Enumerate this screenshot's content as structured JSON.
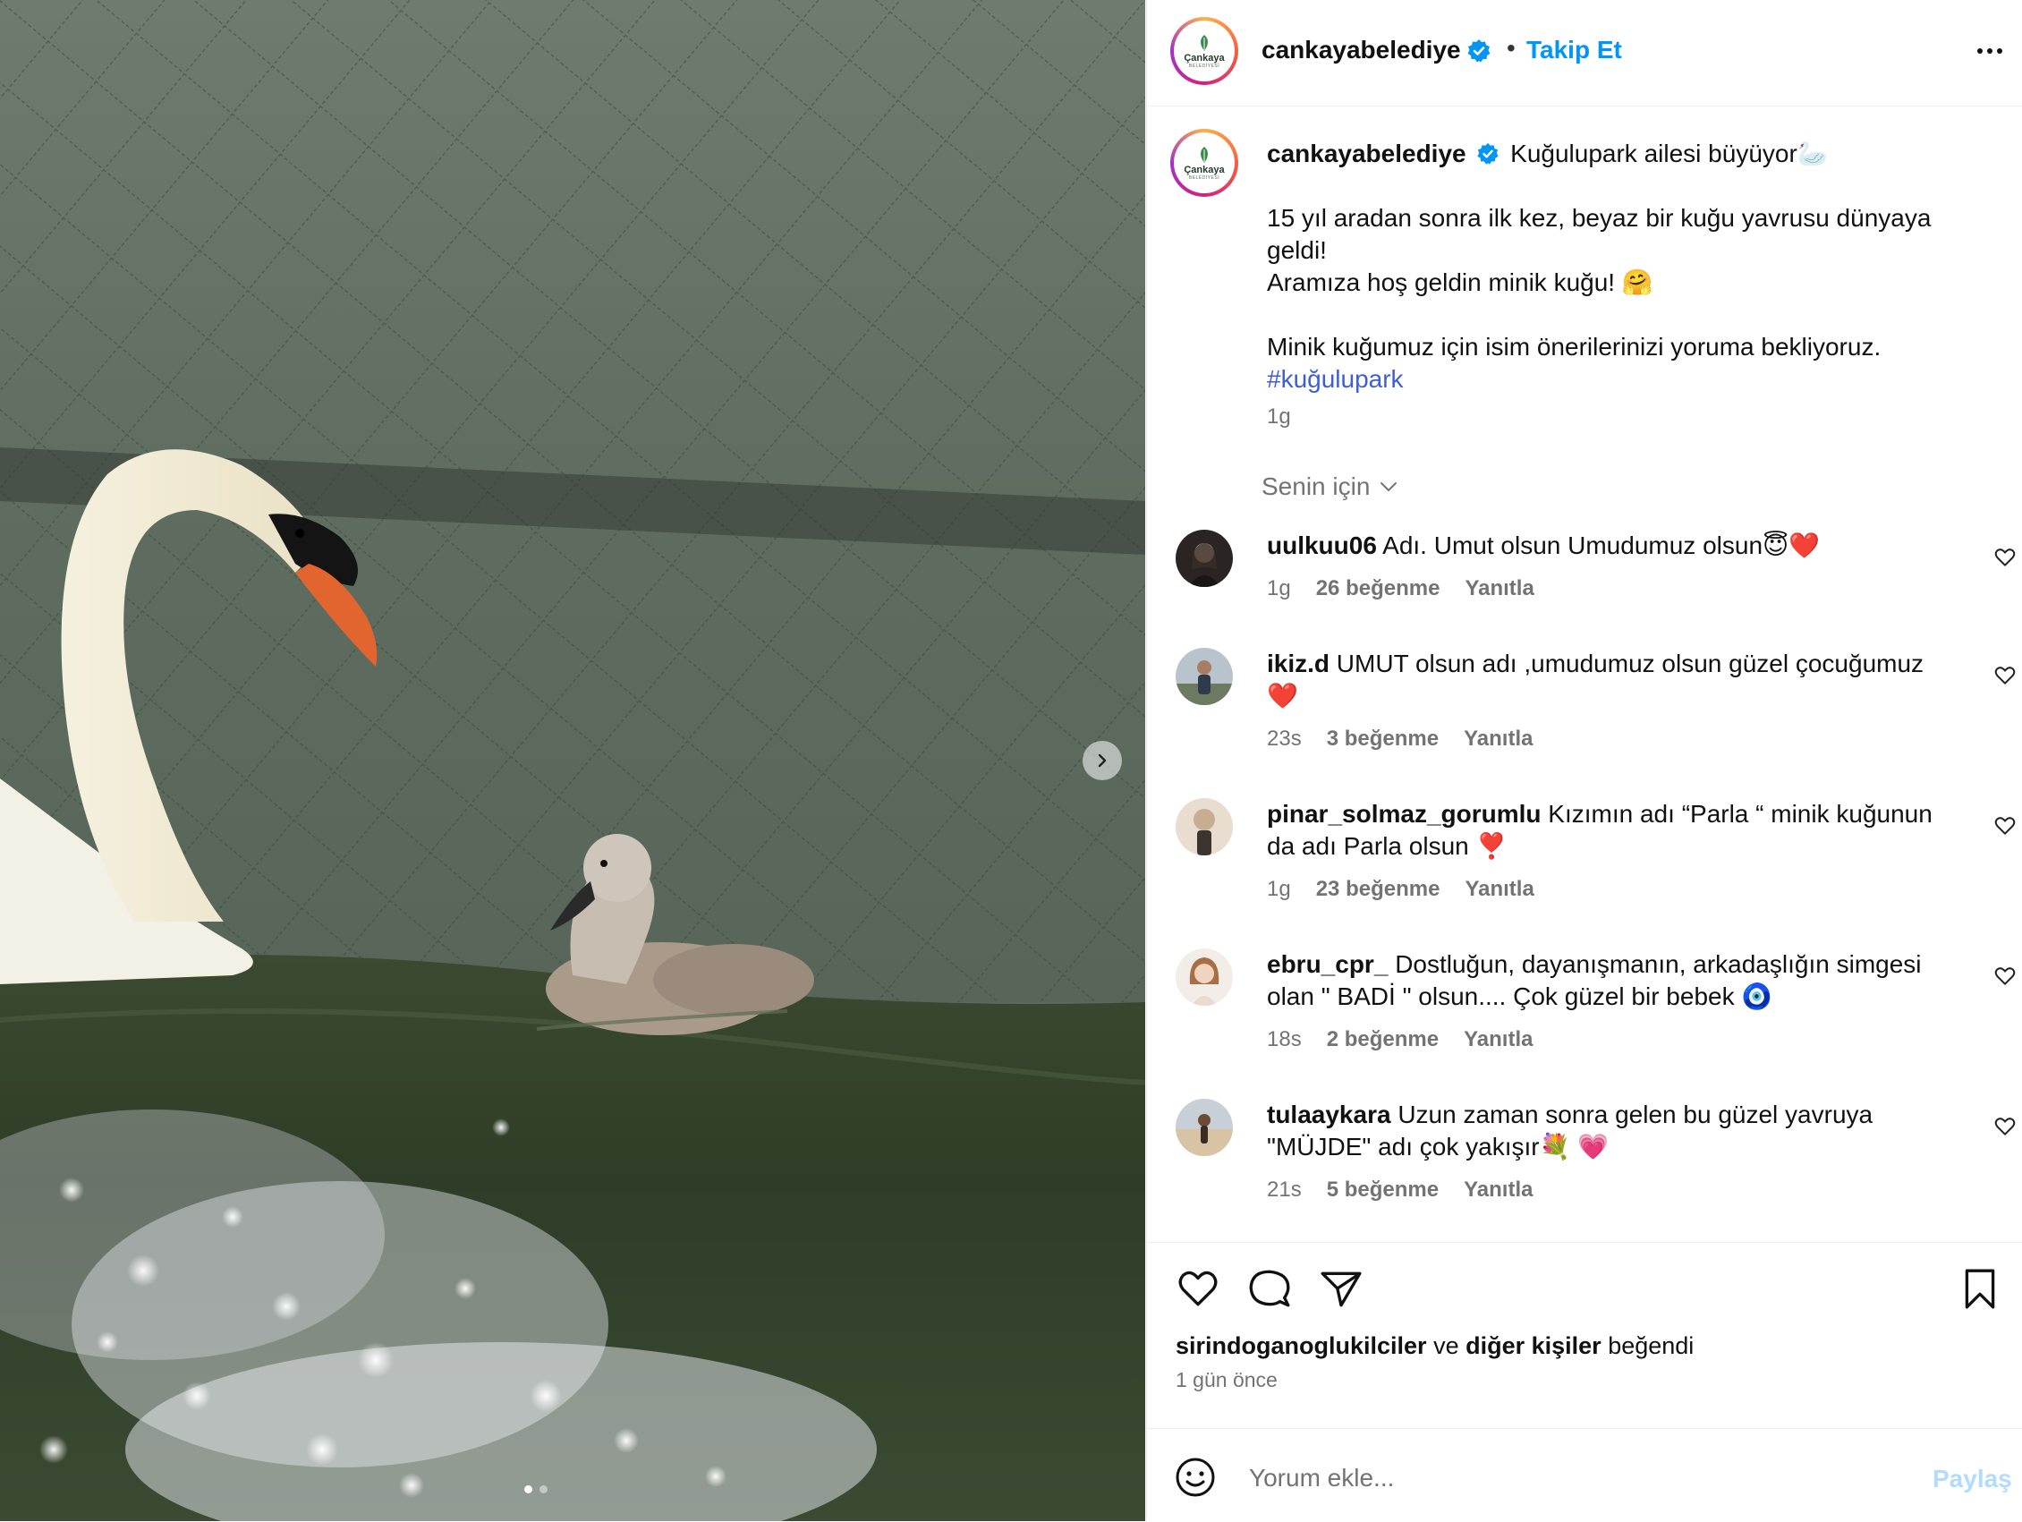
{
  "post": {
    "username": "cankayabelediye",
    "follow_label": "Takip Et",
    "separator": "•",
    "logo_text": "Çankaya",
    "logo_sub": "BELEDİYESİ"
  },
  "caption": {
    "username": "cankayabelediye",
    "line1": "Kuğulupark ailesi büyüyor🦢",
    "line2": "15 yıl aradan sonra ilk kez, beyaz bir kuğu yavrusu dünyaya geldi!",
    "line3": "Aramıza hoş geldin minik kuğu! 🤗",
    "line4": "Minik kuğumuz için isim önerilerinizi yoruma bekliyoruz.",
    "hashtag": "#kuğulupark",
    "time": "1g"
  },
  "comments_filter": "Senin için",
  "comments": [
    {
      "username": "uulkuu06",
      "text": "Adı. Umut olsun Umudumuz olsun😇❤️",
      "time": "1g",
      "likes": "26 beğenme",
      "reply": "Yanıtla"
    },
    {
      "username": "ikiz.d",
      "text": "UMUT olsun adı ,umudumuz olsun güzel çocuğumuz ❤️",
      "time": "23s",
      "likes": "3 beğenme",
      "reply": "Yanıtla"
    },
    {
      "username": "pinar_solmaz_gorumlu",
      "text": "Kızımın adı “Parla “ minik kuğunun da adı Parla olsun ❣️",
      "time": "1g",
      "likes": "23 beğenme",
      "reply": "Yanıtla"
    },
    {
      "username": "ebru_cpr_",
      "text": "Dostluğun, dayanışmanın, arkadaşlığın simgesi olan \" BADİ \" olsun.... Çok güzel bir bebek 🧿",
      "time": "18s",
      "likes": "2 beğenme",
      "reply": "Yanıtla"
    },
    {
      "username": "tulaaykara",
      "text": "Uzun zaman sonra gelen bu güzel yavruya \"MÜJDE\" adı çok yakışır💐 💗",
      "time": "21s",
      "likes": "5 beğenme",
      "reply": "Yanıtla"
    }
  ],
  "likes": {
    "user": "sirindoganoglukilciler",
    "connector": "ve",
    "others": "diğer kişiler",
    "suffix": "beğendi",
    "ago": "1 gün önce"
  },
  "composer": {
    "placeholder": "Yorum ekle...",
    "share_label": "Paylaş"
  },
  "icons": {
    "verified": "verified-badge-icon",
    "more": "more-options-icon",
    "like": "heart-icon",
    "comment": "comment-icon",
    "share": "send-icon",
    "save": "bookmark-icon",
    "emoji": "emoji-icon",
    "chevron": "chevron-down-icon",
    "next": "chevron-right-icon"
  },
  "colors": {
    "link": "#0095f6",
    "verified": "#0095f6",
    "muted": "#737373",
    "hashtag": "#3f5ed0",
    "share_disabled": "#b3dbff"
  }
}
